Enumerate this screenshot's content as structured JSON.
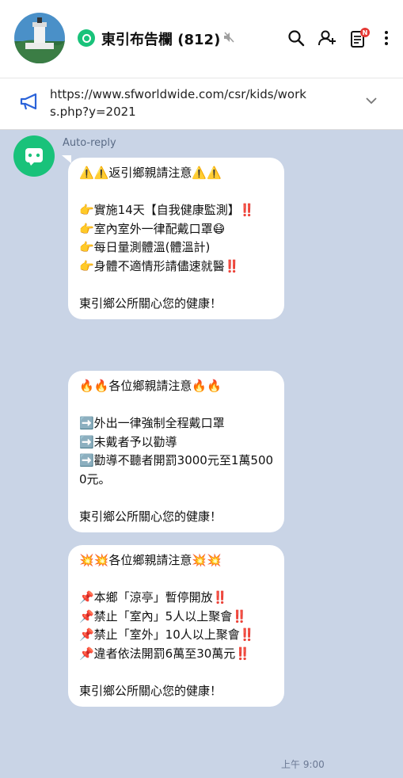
{
  "header": {
    "title": "東引布告欄 (812)",
    "icons": [
      "search-icon",
      "add-friend-icon",
      "notes-icon",
      "more-icon"
    ],
    "notes_badge": "N"
  },
  "announcement": {
    "text": "https://www.sfworldwide.com/csr/kids/works.php?y=2021"
  },
  "chat": {
    "sender_label": "Auto-reply",
    "messages": [
      "⚠️⚠️返引鄉親請注意⚠️⚠️\n\n👉實施14天【自我健康監測】‼️\n👉室內室外一律配戴口罩😷\n👉每日量測體溫(體溫計)\n👉身體不適情形請儘速就醫‼️\n\n東引鄉公所關心您的健康！",
      "🔥🔥各位鄉親請注意🔥🔥\n\n➡️外出一律強制全程戴口罩\n➡️未戴者予以勸導\n➡️勸導不聽者開罰3000元至1萬5000元。\n\n東引鄉公所關心您的健康！",
      "💥💥各位鄉親請注意💥💥\n\n📌本鄉「涼亭」暫停開放‼️\n📌禁止「室內」5人以上聚會‼️\n📌禁止「室外」10人以上聚會‼️\n📌違者依法開罰6萬至30萬元‼️\n\n東引鄉公所關心您的健康！"
    ],
    "time": "上午 9:00"
  },
  "colors": {
    "chat_bg": "#c9d4e6",
    "brand_green": "#19c27a",
    "badge_red": "#e53935"
  }
}
